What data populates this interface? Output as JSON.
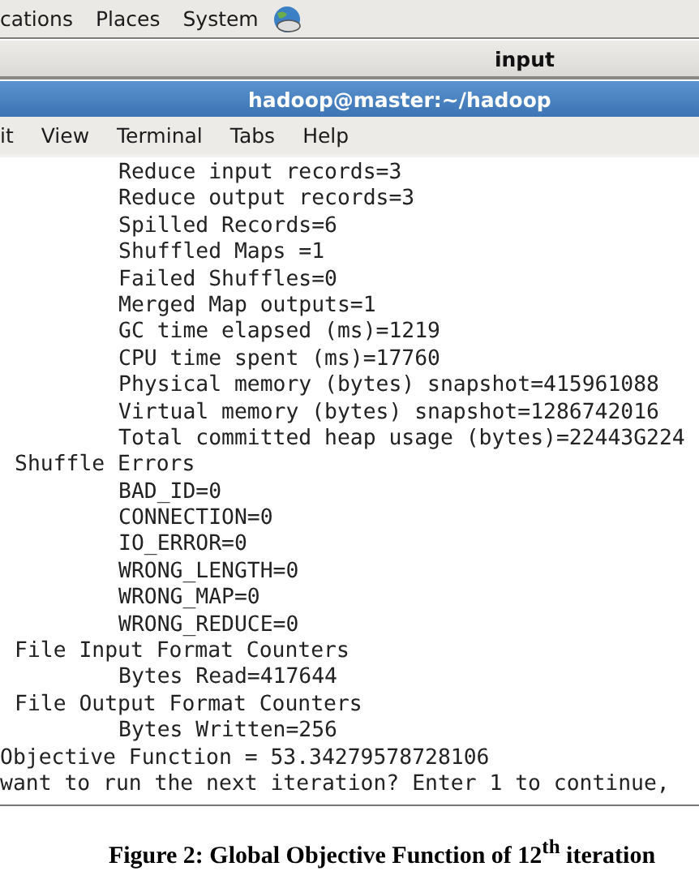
{
  "panel": {
    "menus": [
      "cations",
      "Places",
      "System"
    ]
  },
  "window": {
    "title": "input"
  },
  "terminal": {
    "title": "hadoop@master:~/hadoop",
    "menus": [
      "it",
      "View",
      "Terminal",
      "Tabs",
      "Help"
    ],
    "lines": [
      {
        "kind": "counter",
        "text": "Reduce input records=3"
      },
      {
        "kind": "counter",
        "text": "Reduce output records=3"
      },
      {
        "kind": "counter",
        "text": "Spilled Records=6"
      },
      {
        "kind": "counter",
        "text": "Shuffled Maps =1"
      },
      {
        "kind": "counter",
        "text": "Failed Shuffles=0"
      },
      {
        "kind": "counter",
        "text": "Merged Map outputs=1"
      },
      {
        "kind": "counter",
        "text": "GC time elapsed (ms)=1219"
      },
      {
        "kind": "counter",
        "text": "CPU time spent (ms)=17760"
      },
      {
        "kind": "counter",
        "text": "Physical memory (bytes) snapshot=415961088"
      },
      {
        "kind": "counter",
        "text": "Virtual memory (bytes) snapshot=1286742016"
      },
      {
        "kind": "counter",
        "text": "Total committed heap usage (bytes)=22443G224"
      },
      {
        "kind": "group",
        "text": "Shuffle Errors"
      },
      {
        "kind": "counter",
        "text": "BAD_ID=0"
      },
      {
        "kind": "counter",
        "text": "CONNECTION=0"
      },
      {
        "kind": "counter",
        "text": "IO_ERROR=0"
      },
      {
        "kind": "counter",
        "text": "WRONG_LENGTH=0"
      },
      {
        "kind": "counter",
        "text": "WRONG_MAP=0"
      },
      {
        "kind": "counter",
        "text": "WRONG_REDUCE=0"
      },
      {
        "kind": "group",
        "text": "File Input Format Counters"
      },
      {
        "kind": "counter",
        "text": "Bytes Read=417644"
      },
      {
        "kind": "group",
        "text": "File Output Format Counters"
      },
      {
        "kind": "counter",
        "text": "Bytes Written=256"
      },
      {
        "kind": "output",
        "text": "Objective Function = 53.34279578728106"
      },
      {
        "kind": "output",
        "text": "want to run the next iteration? Enter 1 to continue,"
      }
    ]
  },
  "caption": "Figure 2: Global Objective Function of 12$^{th}$ iteration"
}
